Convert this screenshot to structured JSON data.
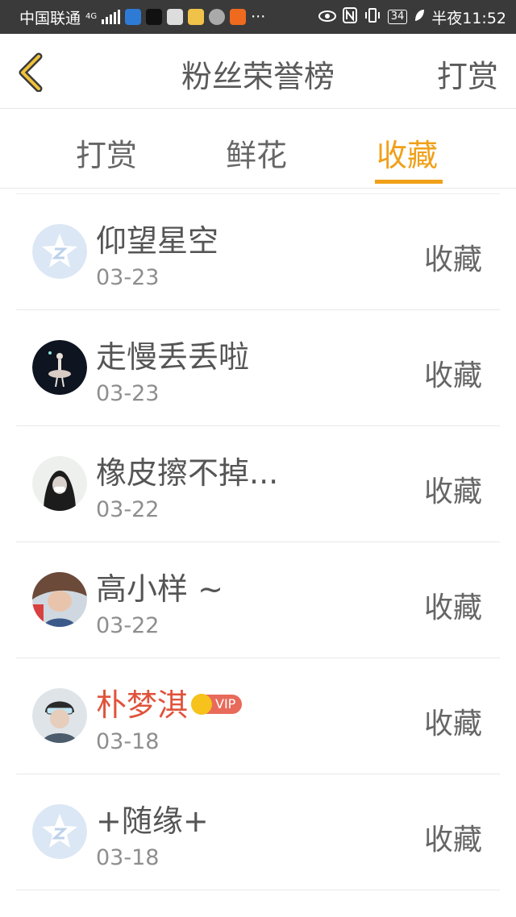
{
  "status_bar": {
    "carrier": "中国联通",
    "network": "4G",
    "more": "···",
    "battery": "34",
    "time": "半夜11:52"
  },
  "header": {
    "title": "粉丝荣誉榜",
    "right_action": "打赏"
  },
  "tabs": [
    {
      "label": "打赏",
      "active": false
    },
    {
      "label": "鲜花",
      "active": false
    },
    {
      "label": "收藏",
      "active": true
    }
  ],
  "colors": {
    "accent": "#f0a019",
    "vip_name": "#e0533b"
  },
  "fans": [
    {
      "name": "仰望星空",
      "date": "03-23",
      "action": "收藏",
      "avatar": "default-star-avatar"
    },
    {
      "name": "走慢丢丢啦",
      "date": "03-23",
      "action": "收藏",
      "avatar": "ballerina-avatar"
    },
    {
      "name": "橡皮擦不掉...",
      "date": "03-22",
      "action": "收藏",
      "avatar": "hooded-girl-avatar"
    },
    {
      "name": "高小样 ~",
      "date": "03-22",
      "action": "收藏",
      "avatar": "photo-avatar"
    },
    {
      "name": "朴梦淇",
      "date": "03-18",
      "action": "收藏",
      "avatar": "photo-avatar",
      "vip": true,
      "vip_label": "VIP"
    },
    {
      "name": "+随缘+",
      "date": "03-18",
      "action": "收藏",
      "avatar": "default-star-avatar"
    }
  ]
}
